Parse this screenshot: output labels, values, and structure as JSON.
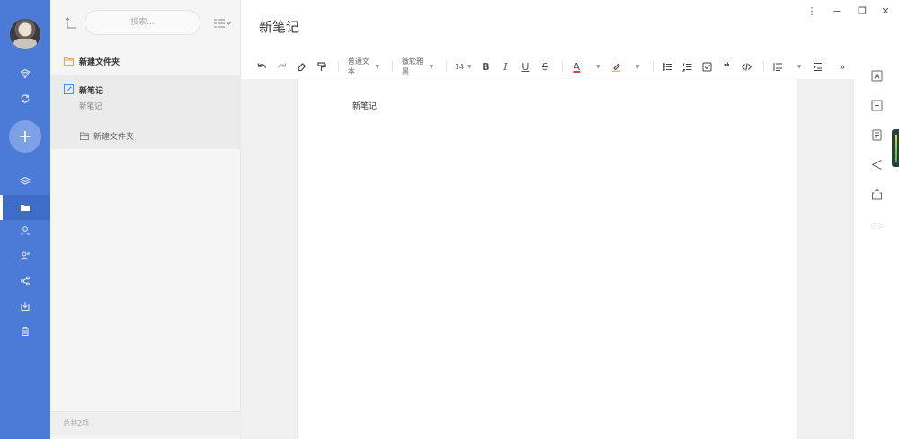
{
  "sidebar": {
    "items": [
      {
        "name": "chat-icon"
      },
      {
        "name": "sync-icon"
      },
      {
        "name": "layers-icon"
      },
      {
        "name": "folder-icon",
        "active": true
      },
      {
        "name": "person-icon"
      },
      {
        "name": "group-icon"
      },
      {
        "name": "share-icon"
      },
      {
        "name": "import-icon"
      },
      {
        "name": "trash-icon"
      }
    ],
    "accent": "#4b7bd6"
  },
  "panel": {
    "search_placeholder": "搜索...",
    "folder_label": "新建文件夹",
    "note_title": "新笔记",
    "note_preview": "新笔记",
    "sub_folder_label": "新建文件夹",
    "footer": "总共2项"
  },
  "editor": {
    "title": "新笔记",
    "paragraph_style": "普通文本",
    "font_name": "微软雅黑",
    "font_size": "14",
    "content": "新笔记"
  },
  "toolbar": {
    "bold": "B",
    "italic": "I",
    "underline": "U",
    "strike": "S",
    "font_color": "A",
    "more": "»"
  },
  "window": {
    "menu": "⋮",
    "minimize": "−",
    "restore": "❐",
    "close": "✕"
  },
  "rail": {
    "more": "···"
  }
}
